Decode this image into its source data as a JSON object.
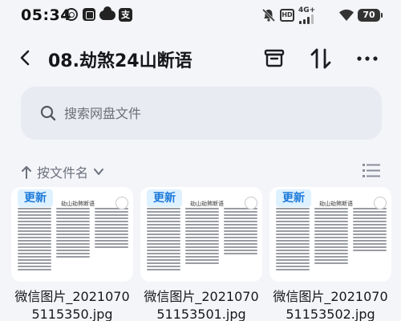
{
  "status_bar": {
    "time": "05:34",
    "network": "4G+",
    "hd": "HD",
    "battery": "70"
  },
  "header": {
    "title": "08.劫煞24山断语"
  },
  "search": {
    "placeholder": "搜索网盘文件"
  },
  "sort": {
    "label": "按文件名"
  },
  "files": [
    {
      "tag": "更新",
      "doc_title": "劫山劫煞断语",
      "name": "微信图片_20210705115350.jpg"
    },
    {
      "tag": "更新",
      "doc_title": "劫山劫煞断语",
      "name": "微信图片_20210705115350​1.jpg"
    },
    {
      "tag": "更新",
      "doc_title": "劫山劫煞断语",
      "name": "微信图片_20210705115350​2.jpg"
    }
  ]
}
